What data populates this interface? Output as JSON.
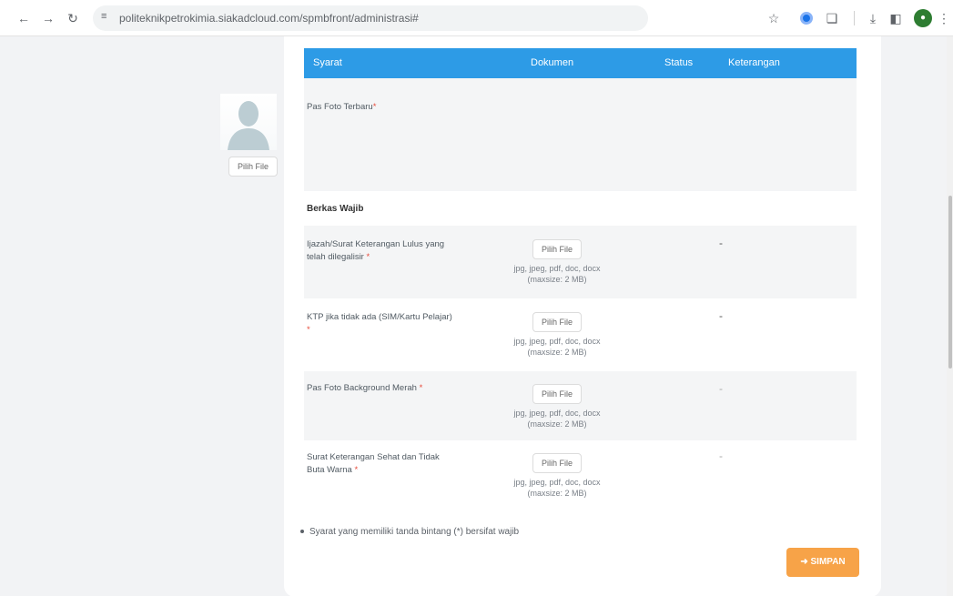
{
  "browser": {
    "url": "politeknikpetrokimia.siakadcloud.com/spmbfront/administrasi#"
  },
  "table": {
    "headers": [
      "Syarat",
      "Dokumen",
      "Status",
      "Keterangan"
    ]
  },
  "photo_row": {
    "label": "Pas Foto Terbaru",
    "star": "*",
    "button": "Pilih File"
  },
  "section_title": "Berkas Wajib",
  "rows": [
    {
      "label": "Ijazah/Surat Keterangan Lulus yang telah dilegalisir",
      "star": "*",
      "button": "Pilih File",
      "hint": "jpg, jpeg, pdf, doc, docx (maxsize: 2 MB)",
      "keterangan": "-"
    },
    {
      "label": "KTP jika tidak ada (SIM/Kartu Pelajar)",
      "star": "*",
      "button": "Pilih File",
      "hint": "jpg, jpeg, pdf, doc, docx (maxsize: 2 MB)",
      "keterangan": "-"
    },
    {
      "label": "Pas Foto Background Merah",
      "star": "*",
      "button": "Pilih File",
      "hint": "jpg, jpeg, pdf, doc, docx (maxsize: 2 MB)",
      "keterangan": "-"
    },
    {
      "label": "Surat Keterangan Sehat dan Tidak Buta Warna",
      "star": "*",
      "button": "Pilih File",
      "hint": "jpg, jpeg, pdf, doc, docx (maxsize: 2 MB)",
      "keterangan": "-"
    }
  ],
  "note": "Syarat yang memiliki tanda bintang (*) bersifat wajib",
  "save_button": "SIMPAN",
  "icons": {
    "back": "arrow-left-icon",
    "forward": "arrow-right-icon",
    "reload": "reload-icon",
    "site_info": "site-settings-icon",
    "bookmark": "star-icon",
    "extension": "puzzle-icon",
    "download": "download-icon",
    "side_panel": "side-panel-icon",
    "save": "arrow-right-icon"
  },
  "colors": {
    "header_blue": "#2d9be6",
    "save_orange": "#f7a348",
    "required_star": "#e74c3c"
  }
}
